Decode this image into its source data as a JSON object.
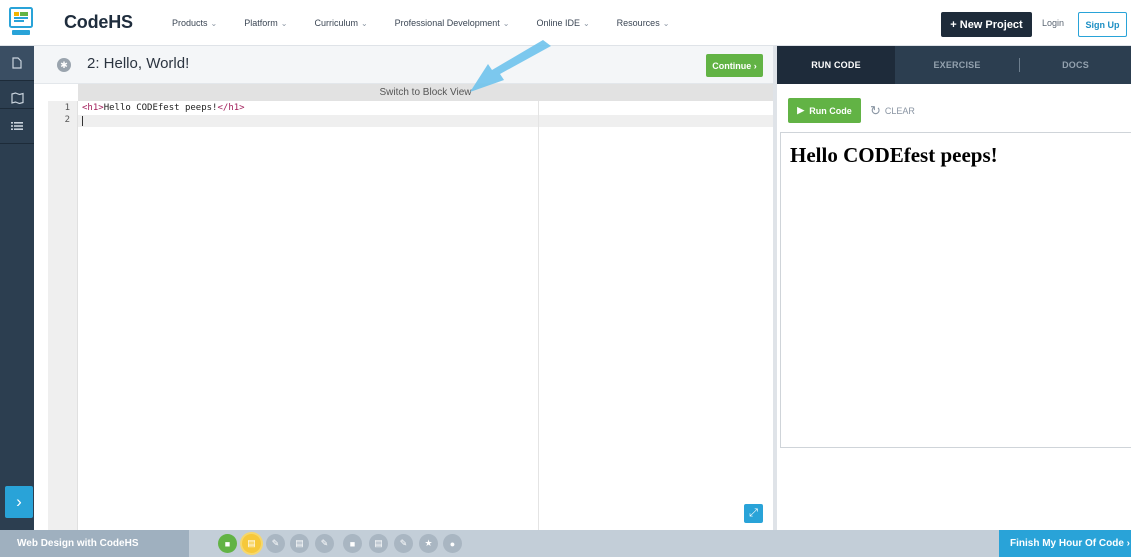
{
  "nav": {
    "brand": "CodeHS",
    "links": [
      {
        "label": "Products"
      },
      {
        "label": "Platform"
      },
      {
        "label": "Curriculum"
      },
      {
        "label": "Professional Development"
      },
      {
        "label": "Online IDE"
      },
      {
        "label": "Resources"
      }
    ],
    "new_project": "+ New Project",
    "login": "Login",
    "signup": "Sign Up"
  },
  "editor": {
    "lesson_title": "2: Hello, World!",
    "continue_label": "Continue ›",
    "switch_view": "Switch to Block View",
    "line_numbers": [
      "1",
      "2"
    ],
    "code": {
      "open_tag": "<h1>",
      "text": "Hello CODEfest peeps!",
      "close_tag": "</h1>"
    }
  },
  "right_panel": {
    "tabs": [
      {
        "label": "RUN CODE",
        "active": true
      },
      {
        "label": "EXERCISE",
        "active": false
      },
      {
        "label": "DOCS",
        "active": false
      }
    ],
    "run_label": "Run Code",
    "clear_label": "CLEAR",
    "output_heading": "Hello CODEfest peeps!"
  },
  "bottom": {
    "course_title": "Web Design with CodeHS",
    "finish_label": "Finish My Hour Of Code  ›",
    "progress_items": [
      {
        "icon": "video-icon",
        "state": "done"
      },
      {
        "icon": "document-icon",
        "state": "current"
      },
      {
        "icon": "pencil-icon",
        "state": "todo"
      },
      {
        "icon": "document-icon",
        "state": "todo"
      },
      {
        "icon": "pencil-icon",
        "state": "todo"
      },
      {
        "icon": "video-icon",
        "state": "todo"
      },
      {
        "icon": "document-icon",
        "state": "todo"
      },
      {
        "icon": "pencil-icon",
        "state": "todo"
      },
      {
        "icon": "star-icon",
        "state": "todo"
      },
      {
        "icon": "circle-icon",
        "state": "todo"
      }
    ]
  },
  "colors": {
    "accent_green": "#62b345",
    "accent_blue": "#29a3d8",
    "dark_navy": "#1e2b3a",
    "rail": "#2c3e50"
  }
}
